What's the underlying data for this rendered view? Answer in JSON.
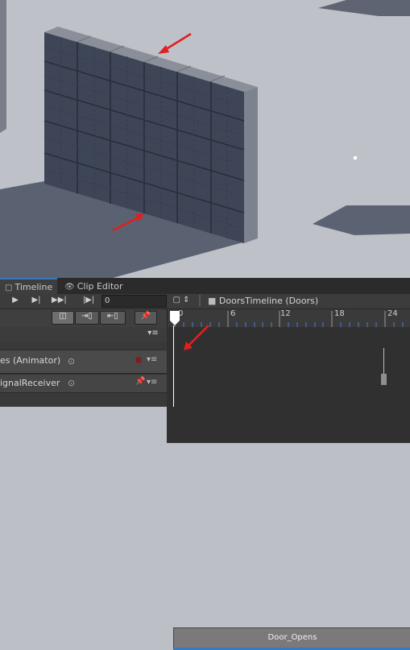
{
  "tabs": [
    {
      "label": "Timeline",
      "icon": "timeline-icon"
    },
    {
      "label": "Clip Editor",
      "icon": "eye-icon"
    }
  ],
  "transport": {
    "frame_value": "0",
    "frame_prefix": "|▶|"
  },
  "breadcrumb": {
    "label": "DoorsTimeline (Doors)"
  },
  "ruler": {
    "ticks": [
      "0",
      "6",
      "12",
      "18",
      "24"
    ]
  },
  "tracks": [
    {
      "label": "es (Animator)",
      "type": "animator"
    },
    {
      "label": "ignalReceiver",
      "type": "signal"
    }
  ],
  "clips": [
    {
      "label": "Door_Opens"
    }
  ],
  "colors": {
    "accent": "#3a79bb",
    "playhead": "#ffffff",
    "annotation_arrow": "#e02020"
  }
}
